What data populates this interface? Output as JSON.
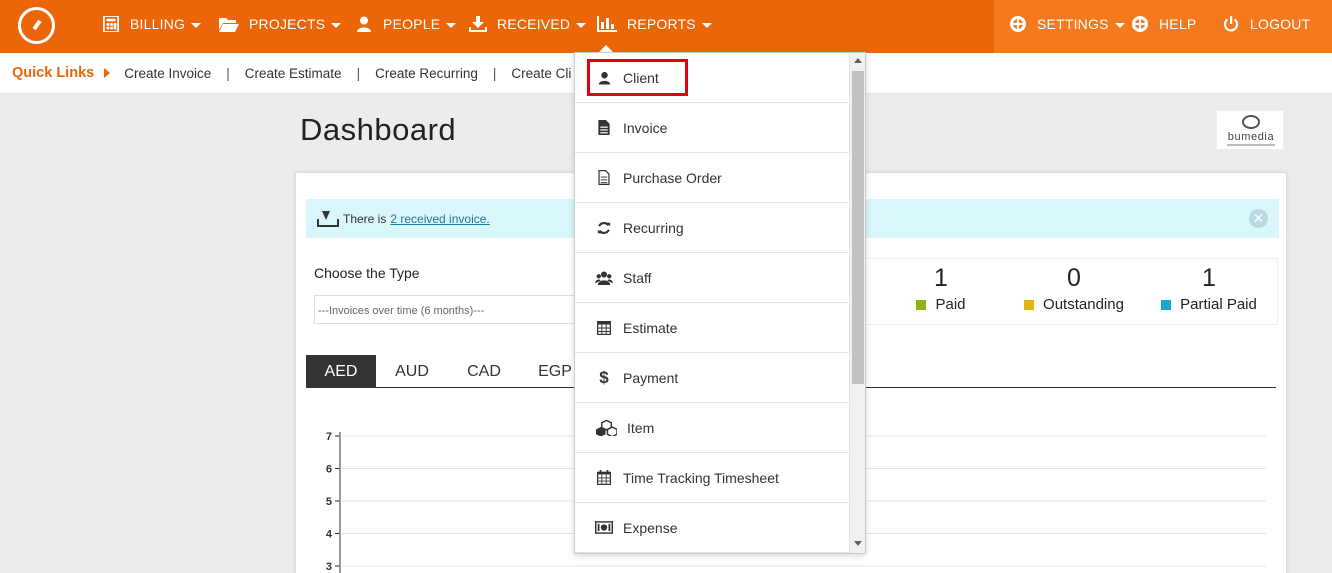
{
  "nav": {
    "items": [
      {
        "label": "BILLING",
        "icon": "calculator-icon",
        "has_caret": true
      },
      {
        "label": "PROJECTS",
        "icon": "folder-open-icon",
        "has_caret": true
      },
      {
        "label": "PEOPLE",
        "icon": "user-icon",
        "has_caret": true
      },
      {
        "label": "RECEIVED",
        "icon": "download-icon",
        "has_caret": true
      },
      {
        "label": "REPORTS",
        "icon": "bar-chart-icon",
        "has_caret": true
      }
    ],
    "right_items": [
      {
        "label": "SETTINGS",
        "icon": "lifebuoy-icon",
        "has_caret": true
      },
      {
        "label": "HELP",
        "icon": "lifebuoy-icon",
        "has_caret": false
      },
      {
        "label": "LOGOUT",
        "icon": "power-icon",
        "has_caret": false
      }
    ],
    "colors": {
      "bar": "#ec6508",
      "right_zone": "#f47a1d"
    }
  },
  "quick_links": {
    "title": "Quick Links",
    "links": [
      "Create Invoice",
      "Create Estimate",
      "Create Recurring",
      "Create Cli"
    ]
  },
  "dashboard": {
    "title": "Dashboard",
    "brand_name": "bumedia",
    "alert": {
      "text": "There is",
      "link": "2 received invoice.",
      "close": "✕"
    },
    "type_label": "Choose the Type",
    "type_value": "---Invoices over time (6 months)---",
    "stats": [
      {
        "value": "1",
        "label": "Paid",
        "color": "#8cb41a"
      },
      {
        "value": "0",
        "label": "Outstanding",
        "color": "#e3b710"
      },
      {
        "value": "1",
        "label": "Partial Paid",
        "color": "#16a9c7"
      }
    ],
    "currency_tabs": [
      "AED",
      "AUD",
      "CAD",
      "EGP"
    ],
    "active_tab": "AED"
  },
  "chart_data": {
    "type": "line",
    "y_ticks": [
      "7",
      "6",
      "5",
      "4",
      "3"
    ],
    "ylim": [
      3,
      7
    ],
    "grid": true
  },
  "reports_menu": {
    "items": [
      {
        "label": "Client",
        "icon": "user-icon"
      },
      {
        "label": "Invoice",
        "icon": "file-text-icon"
      },
      {
        "label": "Purchase Order",
        "icon": "file-outline-icon"
      },
      {
        "label": "Recurring",
        "icon": "refresh-icon"
      },
      {
        "label": "Staff",
        "icon": "users-icon"
      },
      {
        "label": "Estimate",
        "icon": "table-icon"
      },
      {
        "label": "Payment",
        "icon": "dollar-icon"
      },
      {
        "label": "Item",
        "icon": "cubes-icon"
      },
      {
        "label": "Time Tracking Timesheet",
        "icon": "calendar-icon"
      },
      {
        "label": "Expense",
        "icon": "money-icon"
      }
    ],
    "highlighted": "Client"
  }
}
